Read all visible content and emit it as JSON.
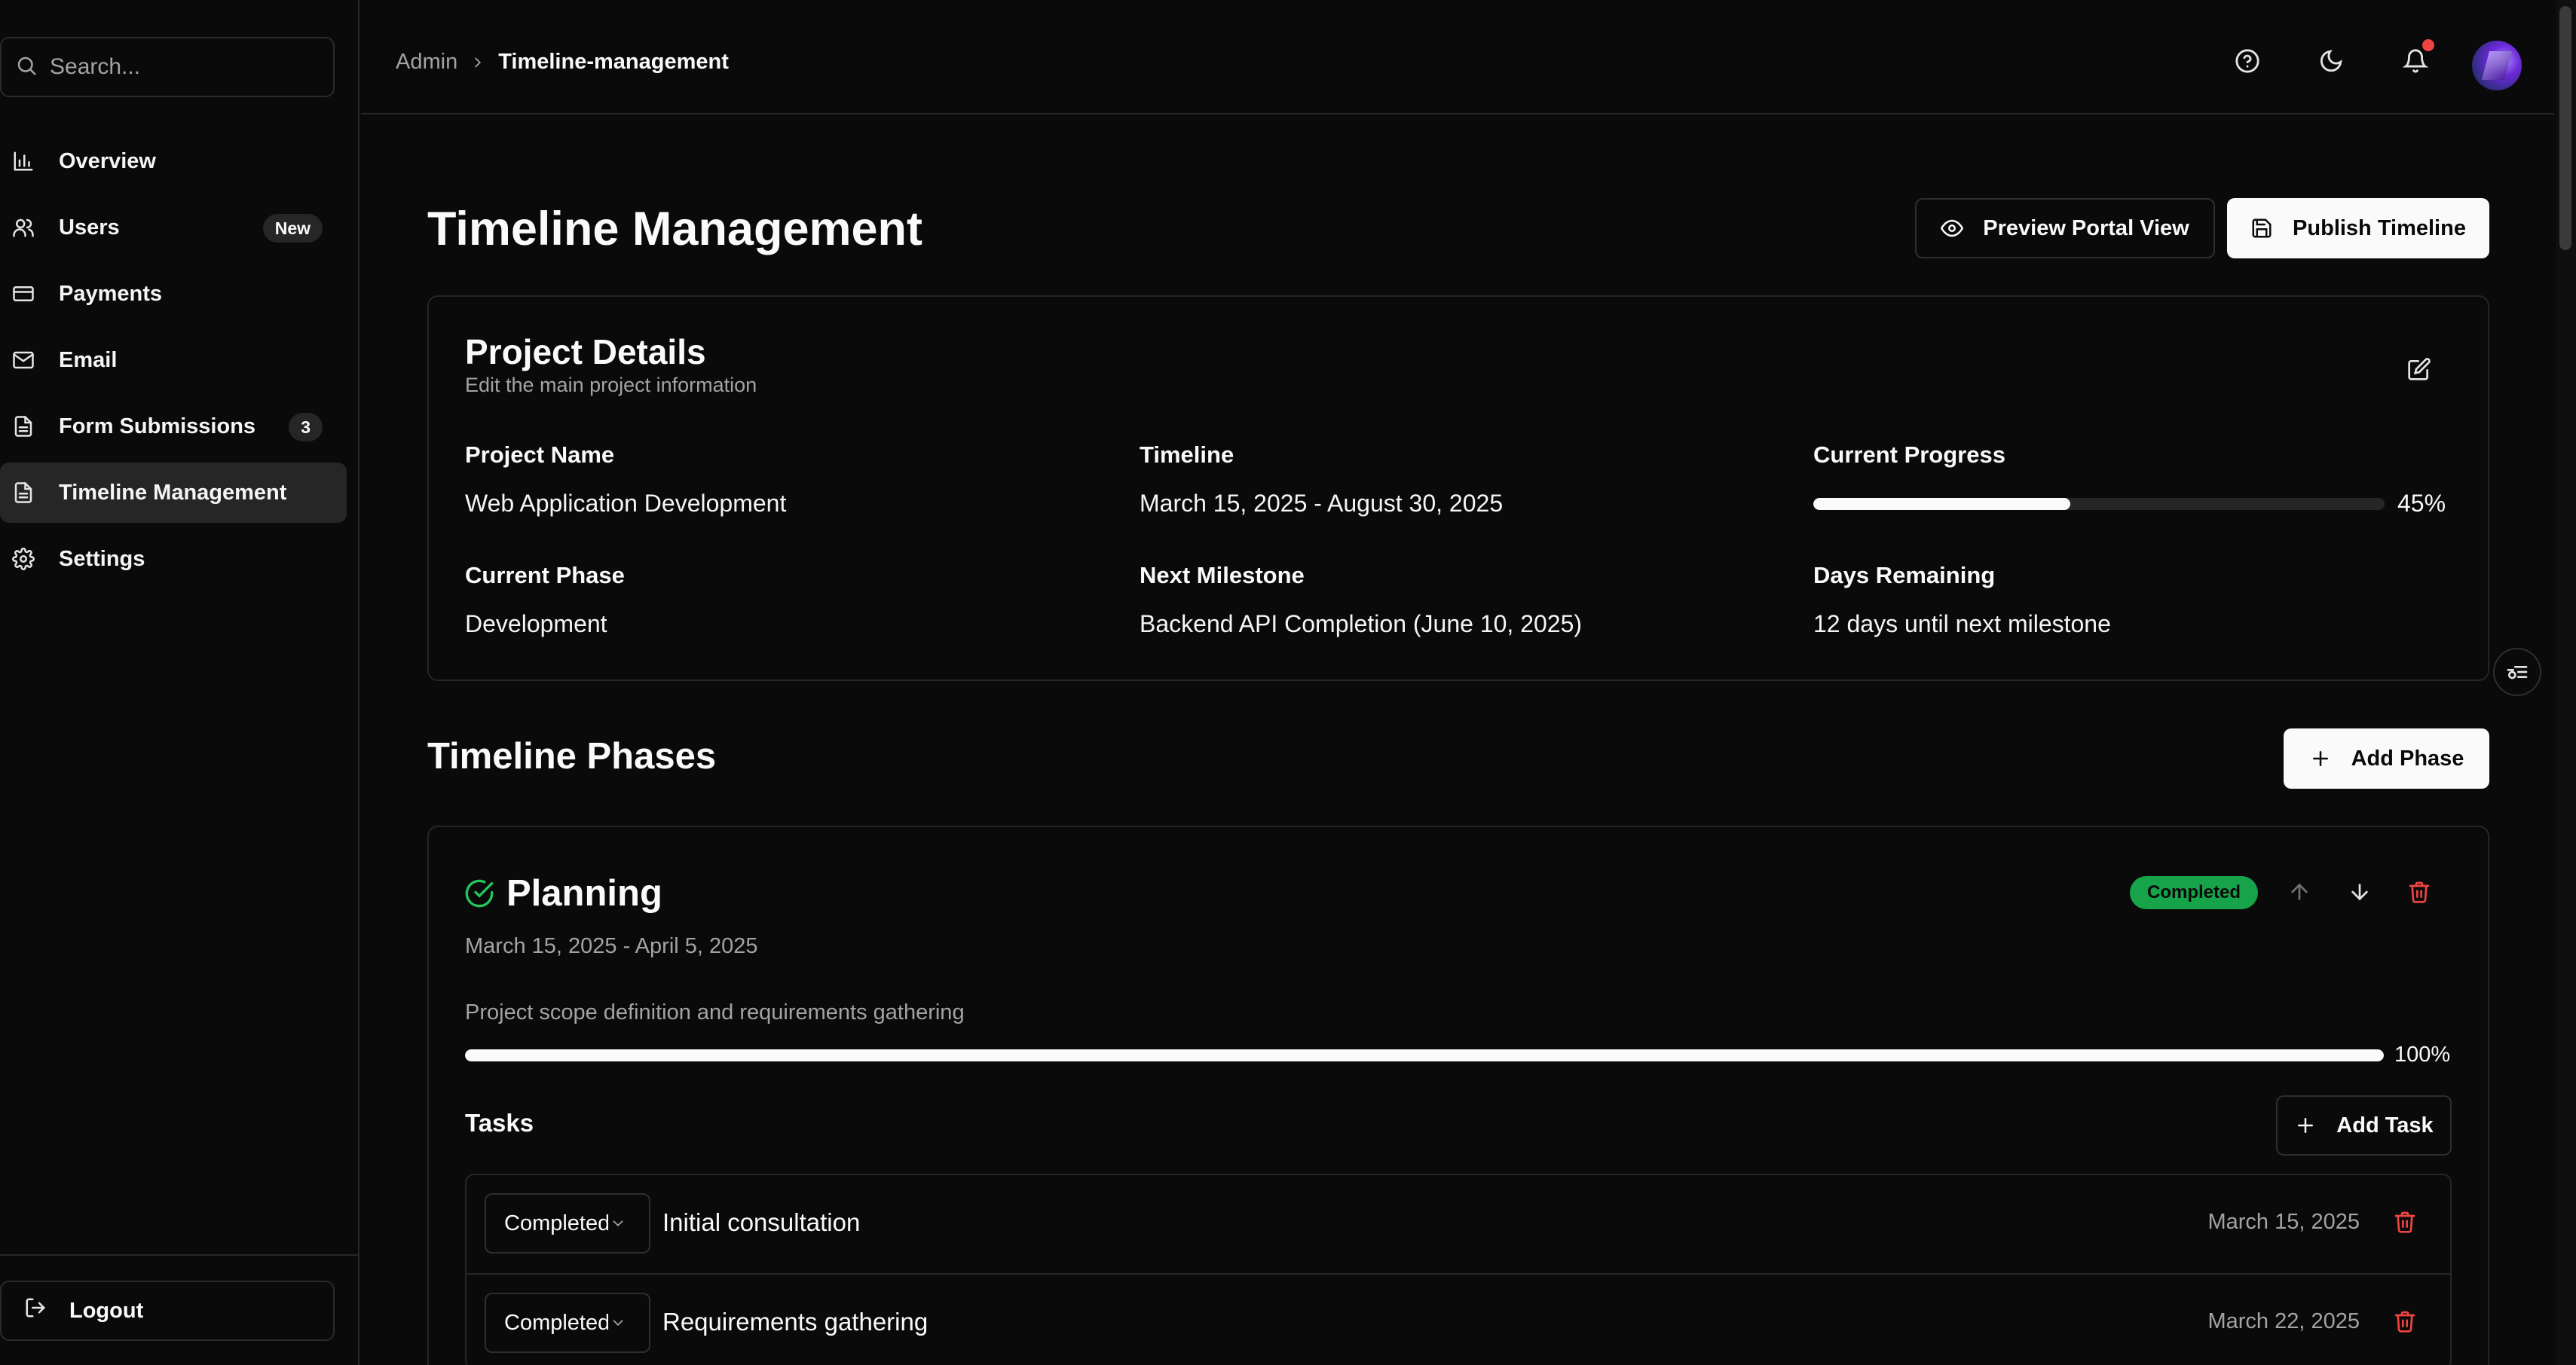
{
  "search": {
    "placeholder": "Search..."
  },
  "sidebar": {
    "items": [
      {
        "label": "Overview",
        "icon": "bar-chart-icon"
      },
      {
        "label": "Users",
        "icon": "users-icon",
        "badge": "New"
      },
      {
        "label": "Payments",
        "icon": "credit-card-icon"
      },
      {
        "label": "Email",
        "icon": "mail-icon"
      },
      {
        "label": "Form Submissions",
        "icon": "file-text-icon",
        "badge": "3"
      },
      {
        "label": "Timeline Management",
        "icon": "file-text-icon",
        "active": true
      },
      {
        "label": "Settings",
        "icon": "gear-icon"
      }
    ],
    "logout_label": "Logout"
  },
  "header": {
    "breadcrumb_root": "Admin",
    "breadcrumb_current": "Timeline-management",
    "icons": [
      "help-circle-icon",
      "moon-icon",
      "bell-icon"
    ],
    "has_notification": true
  },
  "page": {
    "title": "Timeline Management",
    "preview_label": "Preview Portal View",
    "publish_label": "Publish Timeline"
  },
  "project": {
    "title": "Project Details",
    "subtitle": "Edit the main project information",
    "name_label": "Project Name",
    "name_value": "Web Application Development",
    "timeline_label": "Timeline",
    "timeline_value": "March 15, 2025 - August 30, 2025",
    "progress_label": "Current Progress",
    "progress_value": 0.45,
    "progress_text": "45%",
    "phase_label": "Current Phase",
    "phase_value": "Development",
    "milestone_label": "Next Milestone",
    "milestone_value": "Backend API Completion (June 10, 2025)",
    "days_label": "Days Remaining",
    "days_value": "12 days until next milestone"
  },
  "phases_section": {
    "title": "Timeline Phases",
    "add_phase_label": "Add Phase"
  },
  "phase": {
    "title": "Planning",
    "status": "Completed",
    "dates": "March 15, 2025 - April 5, 2025",
    "description": "Project scope definition and requirements gathering",
    "progress_value": 1.0,
    "progress_text": "100%",
    "tasks_label": "Tasks",
    "add_task_label": "Add Task",
    "tasks": [
      {
        "status": "Completed",
        "name": "Initial consultation",
        "date": "March 15, 2025"
      },
      {
        "status": "Completed",
        "name": "Requirements gathering",
        "date": "March 22, 2025"
      }
    ]
  },
  "colors": {
    "background": "#0a0a0a",
    "border": "#262626",
    "success": "#16a34a",
    "danger": "#ef4444",
    "accent": "#fafafa"
  }
}
